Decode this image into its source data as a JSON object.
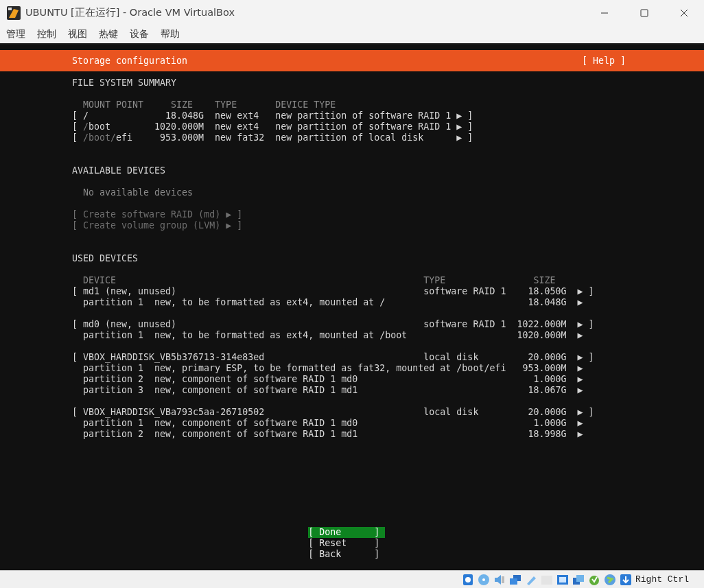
{
  "window": {
    "title": "UBUNTU [正在运行] - Oracle VM VirtualBox"
  },
  "menu": [
    "管理",
    "控制",
    "视图",
    "热键",
    "设备",
    "帮助"
  ],
  "header": {
    "title": "Storage configuration",
    "help": "[ Help ]"
  },
  "filesystem_summary": {
    "title": "FILE SYSTEM SUMMARY",
    "columns": [
      "MOUNT POINT",
      "SIZE",
      "TYPE",
      "DEVICE TYPE"
    ],
    "rows": [
      {
        "open": "[",
        "mount_point": [
          {
            "text": "/",
            "dim": false
          }
        ],
        "size": "18.048G",
        "type": "new ext4",
        "device_type": "new partition of software RAID 1",
        "close": "▶ ]"
      },
      {
        "open": "[",
        "mount_point": [
          {
            "text": "/",
            "dim": true
          },
          {
            "text": "boot",
            "dim": false
          }
        ],
        "size": "1020.000M",
        "type": "new ext4",
        "device_type": "new partition of software RAID 1",
        "close": "▶ ]"
      },
      {
        "open": "[",
        "mount_point": [
          {
            "text": "/boot/",
            "dim": true
          },
          {
            "text": "efi",
            "dim": false
          }
        ],
        "size": "953.000M",
        "type": "new fat32",
        "device_type": "new partition of local disk",
        "close": "▶ ]"
      }
    ]
  },
  "available_devices": {
    "title": "AVAILABLE DEVICES",
    "message": "No available devices",
    "actions": [
      {
        "label": "[ Create software RAID (md) ▶ ]",
        "disabled": true
      },
      {
        "label": "[ Create volume group (LVM) ▶ ]",
        "disabled": true
      }
    ]
  },
  "used_devices": {
    "title": "USED DEVICES",
    "columns": [
      "DEVICE",
      "TYPE",
      "SIZE"
    ],
    "devices": [
      {
        "open": "[",
        "name": "md1 (new, unused)",
        "type": "software RAID 1",
        "size": "18.050G",
        "close": "▶ ]",
        "partitions": [
          {
            "name": "partition 1",
            "description": "new, to be formatted as ext4, mounted at /",
            "size": "18.048G",
            "arrow": "▶"
          }
        ]
      },
      {
        "open": "[",
        "name": "md0 (new, unused)",
        "type": "software RAID 1",
        "size": "1022.000M",
        "close": "▶ ]",
        "partitions": [
          {
            "name": "partition 1",
            "description": "new, to be formatted as ext4, mounted at /boot",
            "size": "1020.000M",
            "arrow": "▶"
          }
        ]
      },
      {
        "open": "[",
        "name": "VBOX_HARDDISK_VB5b376713-314e83ed",
        "type": "local disk",
        "size": "20.000G",
        "close": "▶ ]",
        "partitions": [
          {
            "name": "partition 1",
            "description": "new, primary ESP, to be formatted as fat32, mounted at /boot/efi",
            "size": "953.000M",
            "arrow": "▶"
          },
          {
            "name": "partition 2",
            "description": "new, component of software RAID 1 md0",
            "size": "1.000G",
            "arrow": "▶"
          },
          {
            "name": "partition 3",
            "description": "new, component of software RAID 1 md1",
            "size": "18.067G",
            "arrow": "▶"
          }
        ]
      },
      {
        "open": "[",
        "name": "VBOX_HARDDISK_VBa793c5aa-26710502",
        "type": "local disk",
        "size": "20.000G",
        "close": "▶ ]",
        "partitions": [
          {
            "name": "partition 1",
            "description": "new, component of software RAID 1 md0",
            "size": "1.000G",
            "arrow": "▶"
          },
          {
            "name": "partition 2",
            "description": "new, component of software RAID 1 md1",
            "size": "18.998G",
            "arrow": "▶"
          }
        ]
      }
    ]
  },
  "buttons": [
    {
      "open": "[",
      "label": "Done",
      "close": "]",
      "selected": true
    },
    {
      "open": "[",
      "label": "Reset",
      "close": "]",
      "selected": false
    },
    {
      "open": "[",
      "label": "Back",
      "close": "]",
      "selected": false
    }
  ],
  "status_bar": {
    "host_key": "Right Ctrl"
  }
}
